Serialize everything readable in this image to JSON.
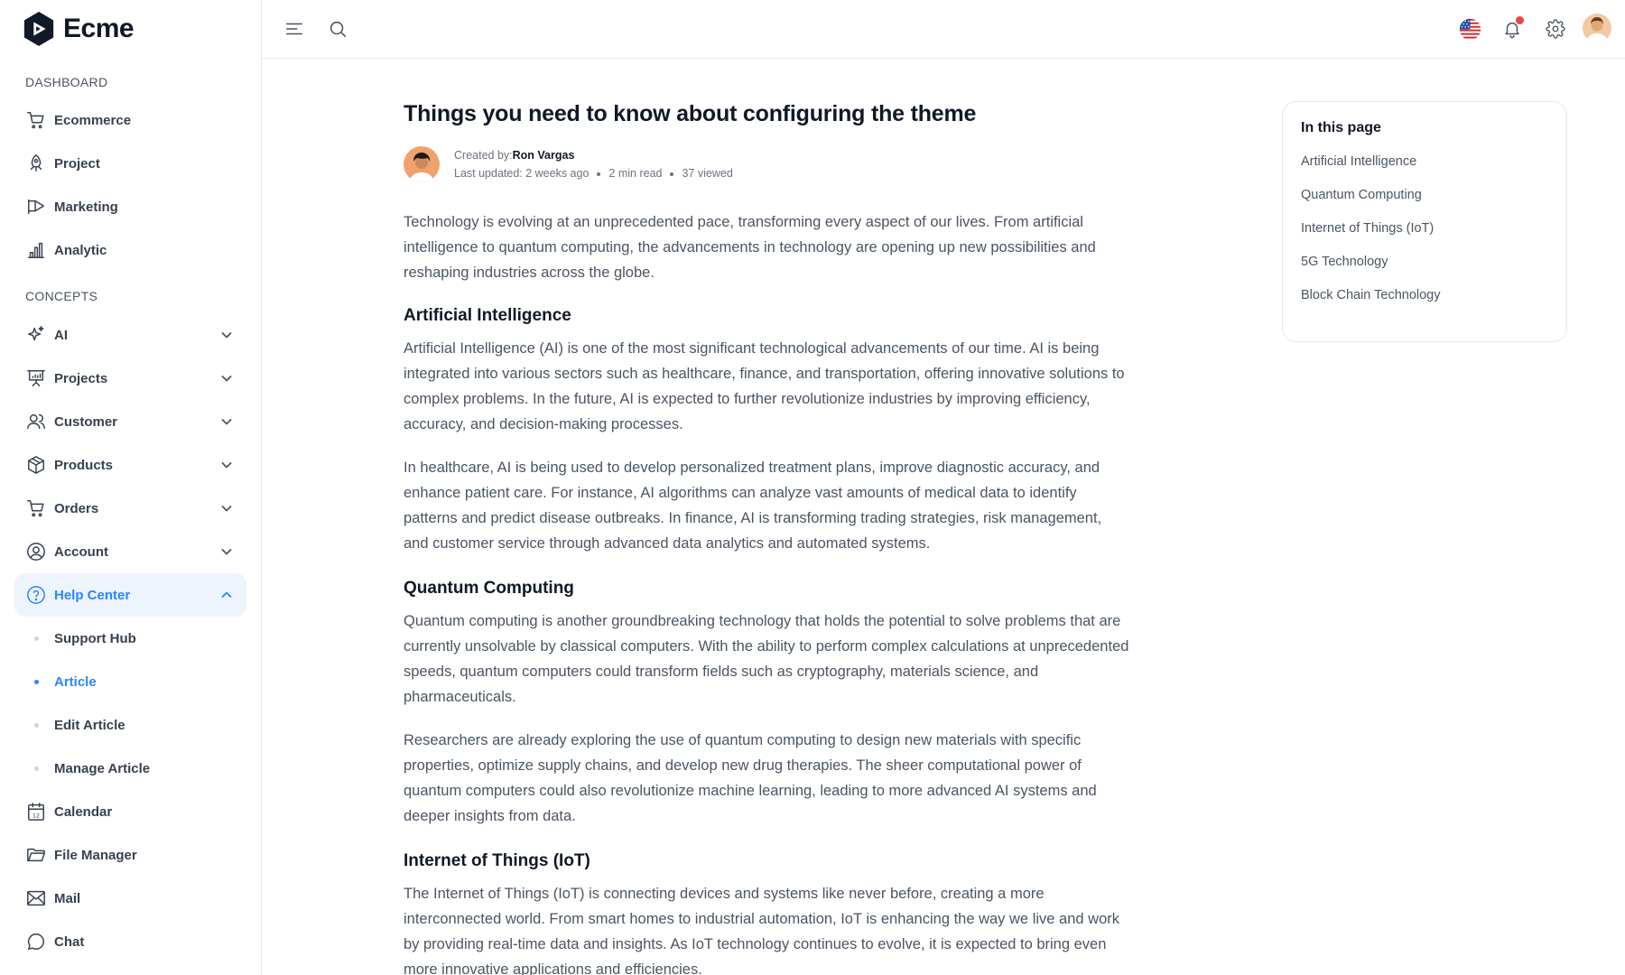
{
  "brand": {
    "name": "Ecme"
  },
  "sidebar": {
    "sections": [
      {
        "title": "DASHBOARD"
      },
      {
        "title": "CONCEPTS"
      }
    ],
    "dashboard_items": [
      {
        "label": "Ecommerce",
        "icon": "cart-icon"
      },
      {
        "label": "Project",
        "icon": "rocket-icon"
      },
      {
        "label": "Marketing",
        "icon": "megaphone-icon"
      },
      {
        "label": "Analytic",
        "icon": "bar-chart-icon"
      }
    ],
    "concept_items": [
      {
        "label": "AI",
        "icon": "sparkle-icon",
        "expandable": true
      },
      {
        "label": "Projects",
        "icon": "presentation-icon",
        "expandable": true
      },
      {
        "label": "Customer",
        "icon": "users-icon",
        "expandable": true
      },
      {
        "label": "Products",
        "icon": "box-icon",
        "expandable": true
      },
      {
        "label": "Orders",
        "icon": "cart-icon",
        "expandable": true
      },
      {
        "label": "Account",
        "icon": "user-circle-icon",
        "expandable": true
      },
      {
        "label": "Help Center",
        "icon": "help-circle-icon",
        "expandable": true,
        "active": true
      }
    ],
    "help_center_subitems": [
      {
        "label": "Support Hub"
      },
      {
        "label": "Article",
        "active": true
      },
      {
        "label": "Edit Article"
      },
      {
        "label": "Manage Article"
      }
    ],
    "bottom_items": [
      {
        "label": "Calendar",
        "icon": "calendar-icon"
      },
      {
        "label": "File Manager",
        "icon": "folder-icon"
      },
      {
        "label": "Mail",
        "icon": "mail-icon"
      },
      {
        "label": "Chat",
        "icon": "chat-icon"
      }
    ],
    "accent_color": "#2a85ff"
  },
  "header": {
    "icons": [
      "menu-icon",
      "search-icon",
      "us-flag-icon",
      "bell-icon",
      "gear-icon",
      "avatar"
    ]
  },
  "article": {
    "title": "Things you need to know about configuring the theme",
    "created_by_label": "Created by:",
    "author": "Ron Vargas",
    "last_updated": "Last updated: 2 weeks ago",
    "read_time": "2 min read",
    "views": "37 viewed",
    "intro": "Technology is evolving at an unprecedented pace, transforming every aspect of our lives. From artificial intelligence to quantum computing, the advancements in technology are opening up new possibilities and reshaping industries across the globe.",
    "sections": [
      {
        "heading": "Artificial Intelligence",
        "paragraphs": [
          "Artificial Intelligence (AI) is one of the most significant technological advancements of our time. AI is being integrated into various sectors such as healthcare, finance, and transportation, offering innovative solutions to complex problems. In the future, AI is expected to further revolutionize industries by improving efficiency, accuracy, and decision-making processes.",
          "In healthcare, AI is being used to develop personalized treatment plans, improve diagnostic accuracy, and enhance patient care. For instance, AI algorithms can analyze vast amounts of medical data to identify patterns and predict disease outbreaks. In finance, AI is transforming trading strategies, risk management, and customer service through advanced data analytics and automated systems."
        ]
      },
      {
        "heading": "Quantum Computing",
        "paragraphs": [
          "Quantum computing is another groundbreaking technology that holds the potential to solve problems that are currently unsolvable by classical computers. With the ability to perform complex calculations at unprecedented speeds, quantum computers could transform fields such as cryptography, materials science, and pharmaceuticals.",
          "Researchers are already exploring the use of quantum computing to design new materials with specific properties, optimize supply chains, and develop new drug therapies. The sheer computational power of quantum computers could also revolutionize machine learning, leading to more advanced AI systems and deeper insights from data."
        ]
      },
      {
        "heading": "Internet of Things (IoT)",
        "paragraphs": [
          "The Internet of Things (IoT) is connecting devices and systems like never before, creating a more interconnected world. From smart homes to industrial automation, IoT is enhancing the way we live and work by providing real-time data and insights. As IoT technology continues to evolve, it is expected to bring even more innovative applications and efficiencies."
        ]
      }
    ]
  },
  "toc": {
    "title": "In this page",
    "items": [
      "Artificial Intelligence",
      "Quantum Computing",
      "Internet of Things (IoT)",
      "5G Technology",
      "Block Chain Technology"
    ]
  }
}
